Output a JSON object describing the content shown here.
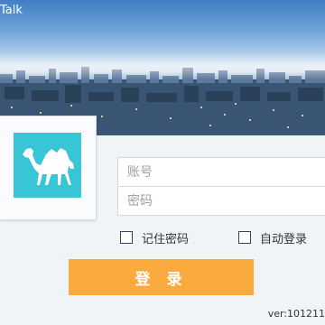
{
  "window": {
    "title_visible": "Talk"
  },
  "login": {
    "account_placeholder": "账号",
    "password_placeholder": "密码",
    "remember_password_label": "记住密码",
    "auto_login_label": "自动登录",
    "login_button_label": "登 录",
    "version_text": "ver:101211"
  },
  "icons": {
    "avatar": "camel-icon"
  },
  "colors": {
    "avatar_bg": "#38c5d5",
    "login_button": "#fbaa3e",
    "panel_bg": "#f1f4f7"
  }
}
